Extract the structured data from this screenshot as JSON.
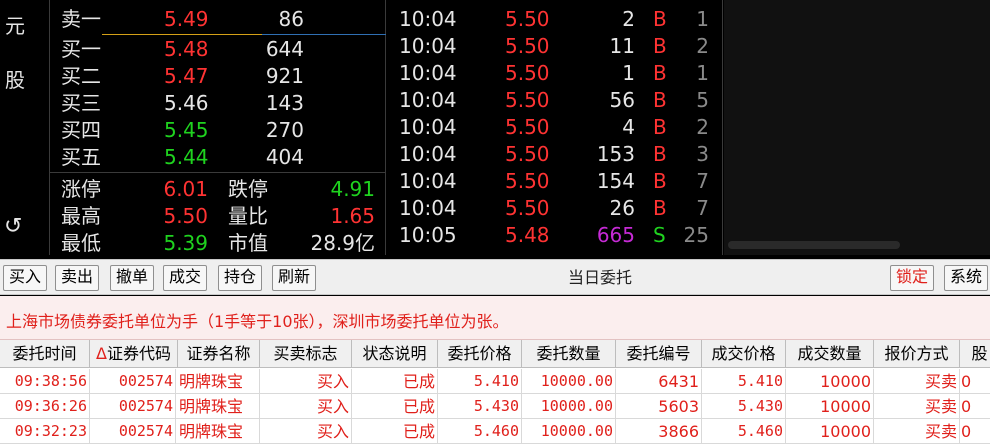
{
  "left_strip": {
    "chars": [
      "元",
      "股"
    ],
    "back_icon": "↺"
  },
  "order_book": {
    "sell": [
      {
        "label": "卖一",
        "price": "5.49",
        "volume": "86",
        "price_color": "red"
      }
    ],
    "buy": [
      {
        "label": "买一",
        "price": "5.48",
        "volume": "644",
        "price_color": "red"
      },
      {
        "label": "买二",
        "price": "5.47",
        "volume": "921",
        "price_color": "red"
      },
      {
        "label": "买三",
        "price": "5.46",
        "volume": "143",
        "price_color": "white"
      },
      {
        "label": "买四",
        "price": "5.45",
        "volume": "270",
        "price_color": "green"
      },
      {
        "label": "买五",
        "price": "5.44",
        "volume": "404",
        "price_color": "green"
      }
    ],
    "stats": [
      {
        "l1": "涨停",
        "v1": "6.01",
        "c1": "red",
        "l2": "跌停",
        "v2": "4.91",
        "c2": "green"
      },
      {
        "l1": "最高",
        "v1": "5.50",
        "c1": "red",
        "l2": "量比",
        "v2": "1.65",
        "c2": "red"
      },
      {
        "l1": "最低",
        "v1": "5.39",
        "c1": "green",
        "l2": "市值",
        "v2": "28.9亿",
        "c2": "white"
      }
    ]
  },
  "ticks": [
    {
      "time": "10:04",
      "price": "5.50",
      "vol": "2",
      "dir": "B",
      "num": "1",
      "vol_color": "white"
    },
    {
      "time": "10:04",
      "price": "5.50",
      "vol": "11",
      "dir": "B",
      "num": "2",
      "vol_color": "white"
    },
    {
      "time": "10:04",
      "price": "5.50",
      "vol": "1",
      "dir": "B",
      "num": "1",
      "vol_color": "white"
    },
    {
      "time": "10:04",
      "price": "5.50",
      "vol": "56",
      "dir": "B",
      "num": "5",
      "vol_color": "white"
    },
    {
      "time": "10:04",
      "price": "5.50",
      "vol": "4",
      "dir": "B",
      "num": "2",
      "vol_color": "white"
    },
    {
      "time": "10:04",
      "price": "5.50",
      "vol": "153",
      "dir": "B",
      "num": "3",
      "vol_color": "white"
    },
    {
      "time": "10:04",
      "price": "5.50",
      "vol": "154",
      "dir": "B",
      "num": "7",
      "vol_color": "white"
    },
    {
      "time": "10:04",
      "price": "5.50",
      "vol": "26",
      "dir": "B",
      "num": "7",
      "vol_color": "white"
    },
    {
      "time": "10:05",
      "price": "5.48",
      "vol": "665",
      "dir": "S",
      "num": "25",
      "vol_color": "magenta"
    }
  ],
  "toolbar": {
    "buttons": [
      "买入",
      "卖出",
      "撤单",
      "成交",
      "持仓",
      "刷新"
    ],
    "title": "当日委托",
    "lock": "锁定",
    "system": "系统"
  },
  "notice": "上海市场债券委托单位为手（1手等于10张），深圳市场委托单位为张。",
  "table": {
    "sort_mark": "Δ",
    "columns": [
      "委托时间",
      "证券代码",
      "证券名称",
      "买卖标志",
      "状态说明",
      "委托价格",
      "委托数量",
      "委托编号",
      "成交价格",
      "成交数量",
      "报价方式",
      "股"
    ],
    "rows": [
      [
        "09:38:56",
        "002574",
        "明牌珠宝",
        "买入",
        "已成",
        "5.410",
        "10000.00",
        "6431",
        "5.410",
        "10000",
        "买卖",
        "0"
      ],
      [
        "09:36:26",
        "002574",
        "明牌珠宝",
        "买入",
        "已成",
        "5.430",
        "10000.00",
        "5603",
        "5.430",
        "10000",
        "买卖",
        "0"
      ],
      [
        "09:32:23",
        "002574",
        "明牌珠宝",
        "买入",
        "已成",
        "5.460",
        "10000.00",
        "3866",
        "5.460",
        "10000",
        "买卖",
        "0"
      ]
    ]
  },
  "colors": {
    "up": "#ff3333",
    "down": "#1fd31f",
    "flat": "#e6e6e6",
    "big": "#c62ad6"
  }
}
